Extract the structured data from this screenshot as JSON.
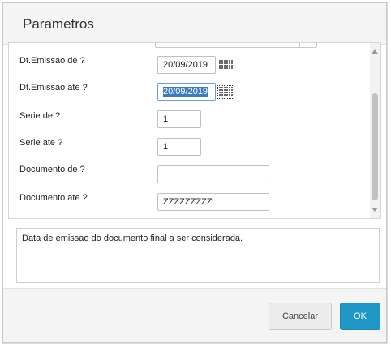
{
  "dialog": {
    "title": "Parametros"
  },
  "fields": [
    {
      "label": "Dt.Emissao de ?",
      "value": "20/09/2019"
    },
    {
      "label": "Dt.Emissao ate ?",
      "value": "20/09/2019"
    },
    {
      "label": "Serie de ?",
      "value": "1"
    },
    {
      "label": "Serie ate ?",
      "value": "1"
    },
    {
      "label": "Documento de ?",
      "value": ""
    },
    {
      "label": "Documento ate ?",
      "value": "ZZZZZZZZZ"
    }
  ],
  "help": {
    "text": "Data de emissao do documento final a ser considerada."
  },
  "buttons": {
    "cancel": "Cancelar",
    "ok": "OK"
  },
  "colors": {
    "ok_button": "#1f98c8",
    "selection": "#3d7bc0"
  }
}
